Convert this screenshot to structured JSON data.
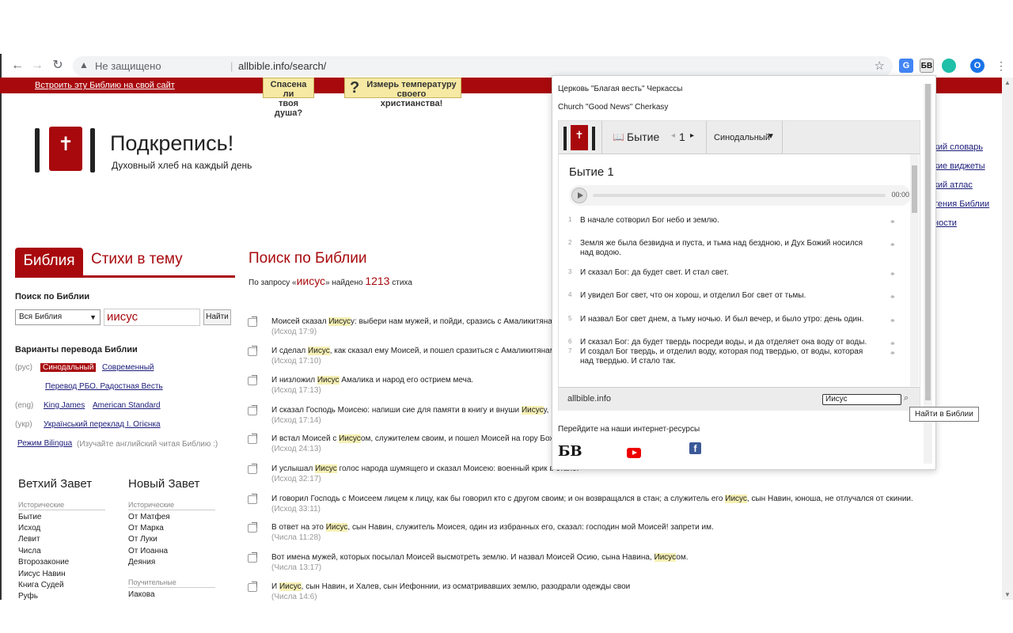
{
  "browser": {
    "back": "←",
    "forward": "→",
    "reload": "↻",
    "warn": "▲",
    "security": "Не защищено",
    "separator": "|",
    "url": "allbible.info/search/",
    "star": "☆",
    "ext_translate": "G",
    "ext_bb": "БВ",
    "profile": "O",
    "menu": "⋮"
  },
  "banner": {
    "embed_link": "Встроить эту Библию на свой сайт",
    "saved_line1": "Спасена ли",
    "saved_line2": "твоя душа?",
    "measure_line1": "Измерь температуру",
    "measure_line2": "своего христианства!"
  },
  "site": {
    "title": "Подкрепись!",
    "subtitle": "Духовный хлеб на каждый день"
  },
  "right_links": [
    "кий словарь",
    "кие виджеты",
    "кий атлас",
    "тения Библии",
    "ности"
  ],
  "sidebar": {
    "tab_bible": "Библия",
    "tab_verses": "Стихи в тему",
    "search_heading": "Поиск по Библии",
    "select_value": "Вся Библия",
    "query": "иисус",
    "find_button": "Найти",
    "translations_heading": "Варианты перевода Библии",
    "langs": [
      "(рус)",
      "(eng)",
      "(укр)"
    ],
    "translations": {
      "synodal": "Синодальный",
      "modern": "Современный",
      "rbo": "Перевод РБО. Радостная Весть",
      "kjv": "King James",
      "asv": "American Standard",
      "ogienko": "Український переклад І. Огієнка"
    },
    "bilingua": "Режим Bilingua",
    "bilingua_note": "(Изучайте английский читая Библию :)",
    "ot_title": "Ветхий Завет",
    "nt_title": "Новый Завет",
    "ot_category": "Исторические",
    "nt_category1": "Исторические",
    "nt_category2": "Поучительные",
    "ot_books": [
      "Бытие",
      "Исход",
      "Левит",
      "Числа",
      "Второзаконие",
      "Иисус Навин",
      "Книга Судей",
      "Руфь"
    ],
    "nt_books": [
      "От Матфея",
      "От Марка",
      "От Луки",
      "От Иоанна",
      "Деяния"
    ],
    "nt_books2": [
      "Иакова"
    ]
  },
  "results": {
    "title": "Поиск по Библии",
    "summary_pre": "По запросу «",
    "summary_q": "иисус",
    "summary_mid": "» найдено ",
    "summary_n": "1213",
    "summary_post": " стиха",
    "items": [
      {
        "before": "Моисей сказал ",
        "hl": "Иисус",
        "after": "у: выбери нам мужей, и пойди, сразись с Амаликитянам",
        "ref": "(Исход 17:9)"
      },
      {
        "before": "И сделал ",
        "hl": "Иисус",
        "after": ", как сказал ему Моисей, и пошел сразиться с Амаликитянам",
        "ref": "(Исход 17:10)"
      },
      {
        "before": "И низложил ",
        "hl": "Иисус",
        "after": " Амалика и народ его острием меча.",
        "ref": "(Исход 17:13)"
      },
      {
        "before": "И сказал Господь Моисею: напиши сие для памяти в книгу и внуши ",
        "hl": "Иисус",
        "after": "у,",
        "ref": "(Исход 17:14)"
      },
      {
        "before": "И встал Моисей с ",
        "hl": "Иисус",
        "after": "ом, служителем своим, и пошел Моисей на гору Бож",
        "ref": "(Исход 24:13)"
      },
      {
        "before": "И услышал ",
        "hl": "Иисус",
        "after": " голос народа шумящего и сказал Моисею: военный крик в стане.",
        "ref": "(Исход 32:17)"
      },
      {
        "before": "И говорил Господь с Моисеем лицем к лицу, как бы говорил кто с другом своим; и он возвращался в стан; а служитель его ",
        "hl": "Иисус",
        "after": ", сын Навин, юноша, не отлучался от скинии.",
        "ref": "(Исход 33:11)"
      },
      {
        "before": "В ответ на это ",
        "hl": "Иисус",
        "after": ", сын Навин, служитель Моисея, один из избранных его, сказал: господин мой Моисей! запрети им.",
        "ref": "(Числа 11:28)"
      },
      {
        "before": "Вот имена мужей, которых посылал Моисей высмотреть землю. И назвал Моисей Осию, сына Навина, ",
        "hl": "Иисус",
        "after": "ом.",
        "ref": "(Числа 13:17)"
      },
      {
        "before": "И ",
        "hl": "Иисус",
        "after": ", сын Навин, и Халев, сын Иефоннии, из осматривавших землю, разодрали одежды свои",
        "ref": "(Числа 14:6)"
      }
    ]
  },
  "popup": {
    "church_ru": "Церковь \"Благая весть\" Черкассы",
    "church_en": "Church \"Good News\" Cherkasy",
    "logo_cross": "✝",
    "book_icon": "📖",
    "book": "Бытие",
    "prev": "◂",
    "chapter": "1",
    "next": "▸",
    "translation": "Синодальный",
    "caret": "▼",
    "chapter_title": "Бытие 1",
    "time": "00:00",
    "link_icon": "⚭",
    "verses": [
      {
        "n": "1",
        "t": "В начале сотворил Бог небо и землю."
      },
      {
        "n": "2",
        "t": "Земля же была безвидна и пуста, и тьма над бездною, и Дух Божий носился над водою."
      },
      {
        "n": "3",
        "t": "И сказал Бог: да будет свет. И стал свет."
      },
      {
        "n": "4",
        "t": "И увидел Бог свет, что он хорош, и отделил Бог свет от тьмы."
      },
      {
        "n": "5",
        "t": "И назвал Бог свет днем, а тьму ночью. И был вечер, и было утро: день один."
      },
      {
        "n": "6",
        "t": "И сказал Бог: да будет твердь посреди воды, и да отделяет она воду от воды."
      },
      {
        "n": "7",
        "t": "И создал Бог твердь, и отделил воду, которая под твердью, от воды, которая над твердью. И стало так."
      }
    ],
    "footer_site": "allbible.info",
    "footer_search_value": "Иисус",
    "mag": "⌕",
    "resources": "Перейдите на наши интернет-ресурсы",
    "bb_logo": "БВ",
    "fb": "f",
    "tooltip": "Найти в Библии"
  },
  "colors": {
    "brand_red": "#a8090d",
    "highlight": "#f6f0b5"
  }
}
